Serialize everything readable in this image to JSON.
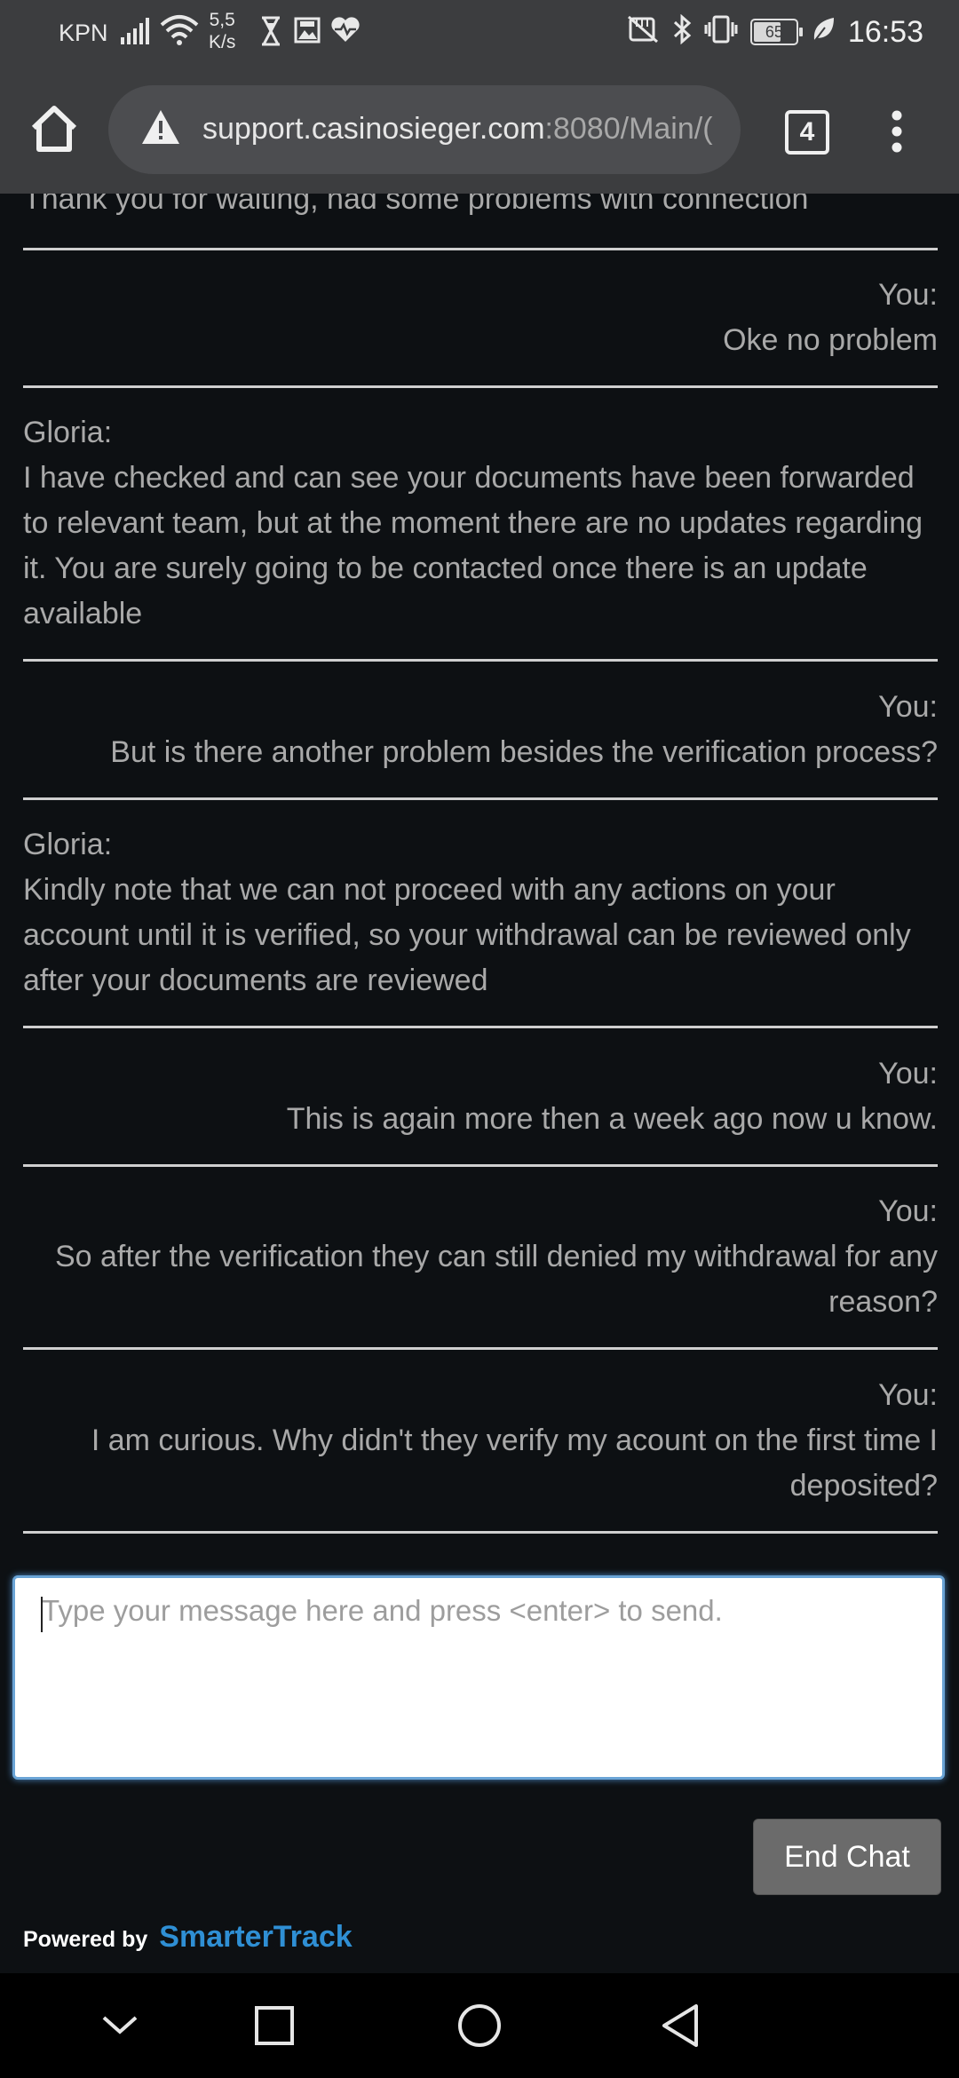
{
  "status_bar": {
    "carrier": "KPN",
    "net_speed_value": "5,5",
    "net_speed_unit": "K/s",
    "battery": "65",
    "time": "16:53"
  },
  "browser": {
    "url_host": "support.casinosieger.com",
    "url_rest": ":8080/Main/(",
    "tab_count": "4"
  },
  "chat": {
    "messages": [
      {
        "sender": "",
        "text": "Thank you for waiting, had some problems with connection",
        "align": "left"
      },
      {
        "sender": "You:",
        "text": "Oke no problem",
        "align": "right"
      },
      {
        "sender": "Gloria:",
        "text": "I have checked and can see your documents have been forwarded to relevant team, but at the moment there are no updates regarding it. You are surely going to be contacted once there is an update available",
        "align": "left"
      },
      {
        "sender": "You:",
        "text": "But is there another problem besides the verification process?",
        "align": "right"
      },
      {
        "sender": "Gloria:",
        "text": "Kindly note that we can not proceed with any actions on your account until it is verified, so your withdrawal can be reviewed only after your documents are reviewed",
        "align": "left"
      },
      {
        "sender": "You:",
        "text": "This is again more then a week ago now u know.",
        "align": "right"
      },
      {
        "sender": "You:",
        "text": "So after the verification they can still denied my withdrawal for any reason?",
        "align": "right"
      },
      {
        "sender": "You:",
        "text": "I am curious. Why didn't they verify my acount on the first time I deposited?",
        "align": "right"
      }
    ],
    "input_placeholder": "Type your message here and press <enter> to send.",
    "input_value": "",
    "end_chat_label": "End Chat"
  },
  "footer": {
    "powered_by": "Powered by",
    "brand": "SmarterTrack"
  },
  "colors": {
    "background": "#0d1013",
    "text": "#a9a9a9",
    "divider": "#cfcfcf",
    "brand": "#2f8fd4",
    "button": "#6b6b6b"
  }
}
